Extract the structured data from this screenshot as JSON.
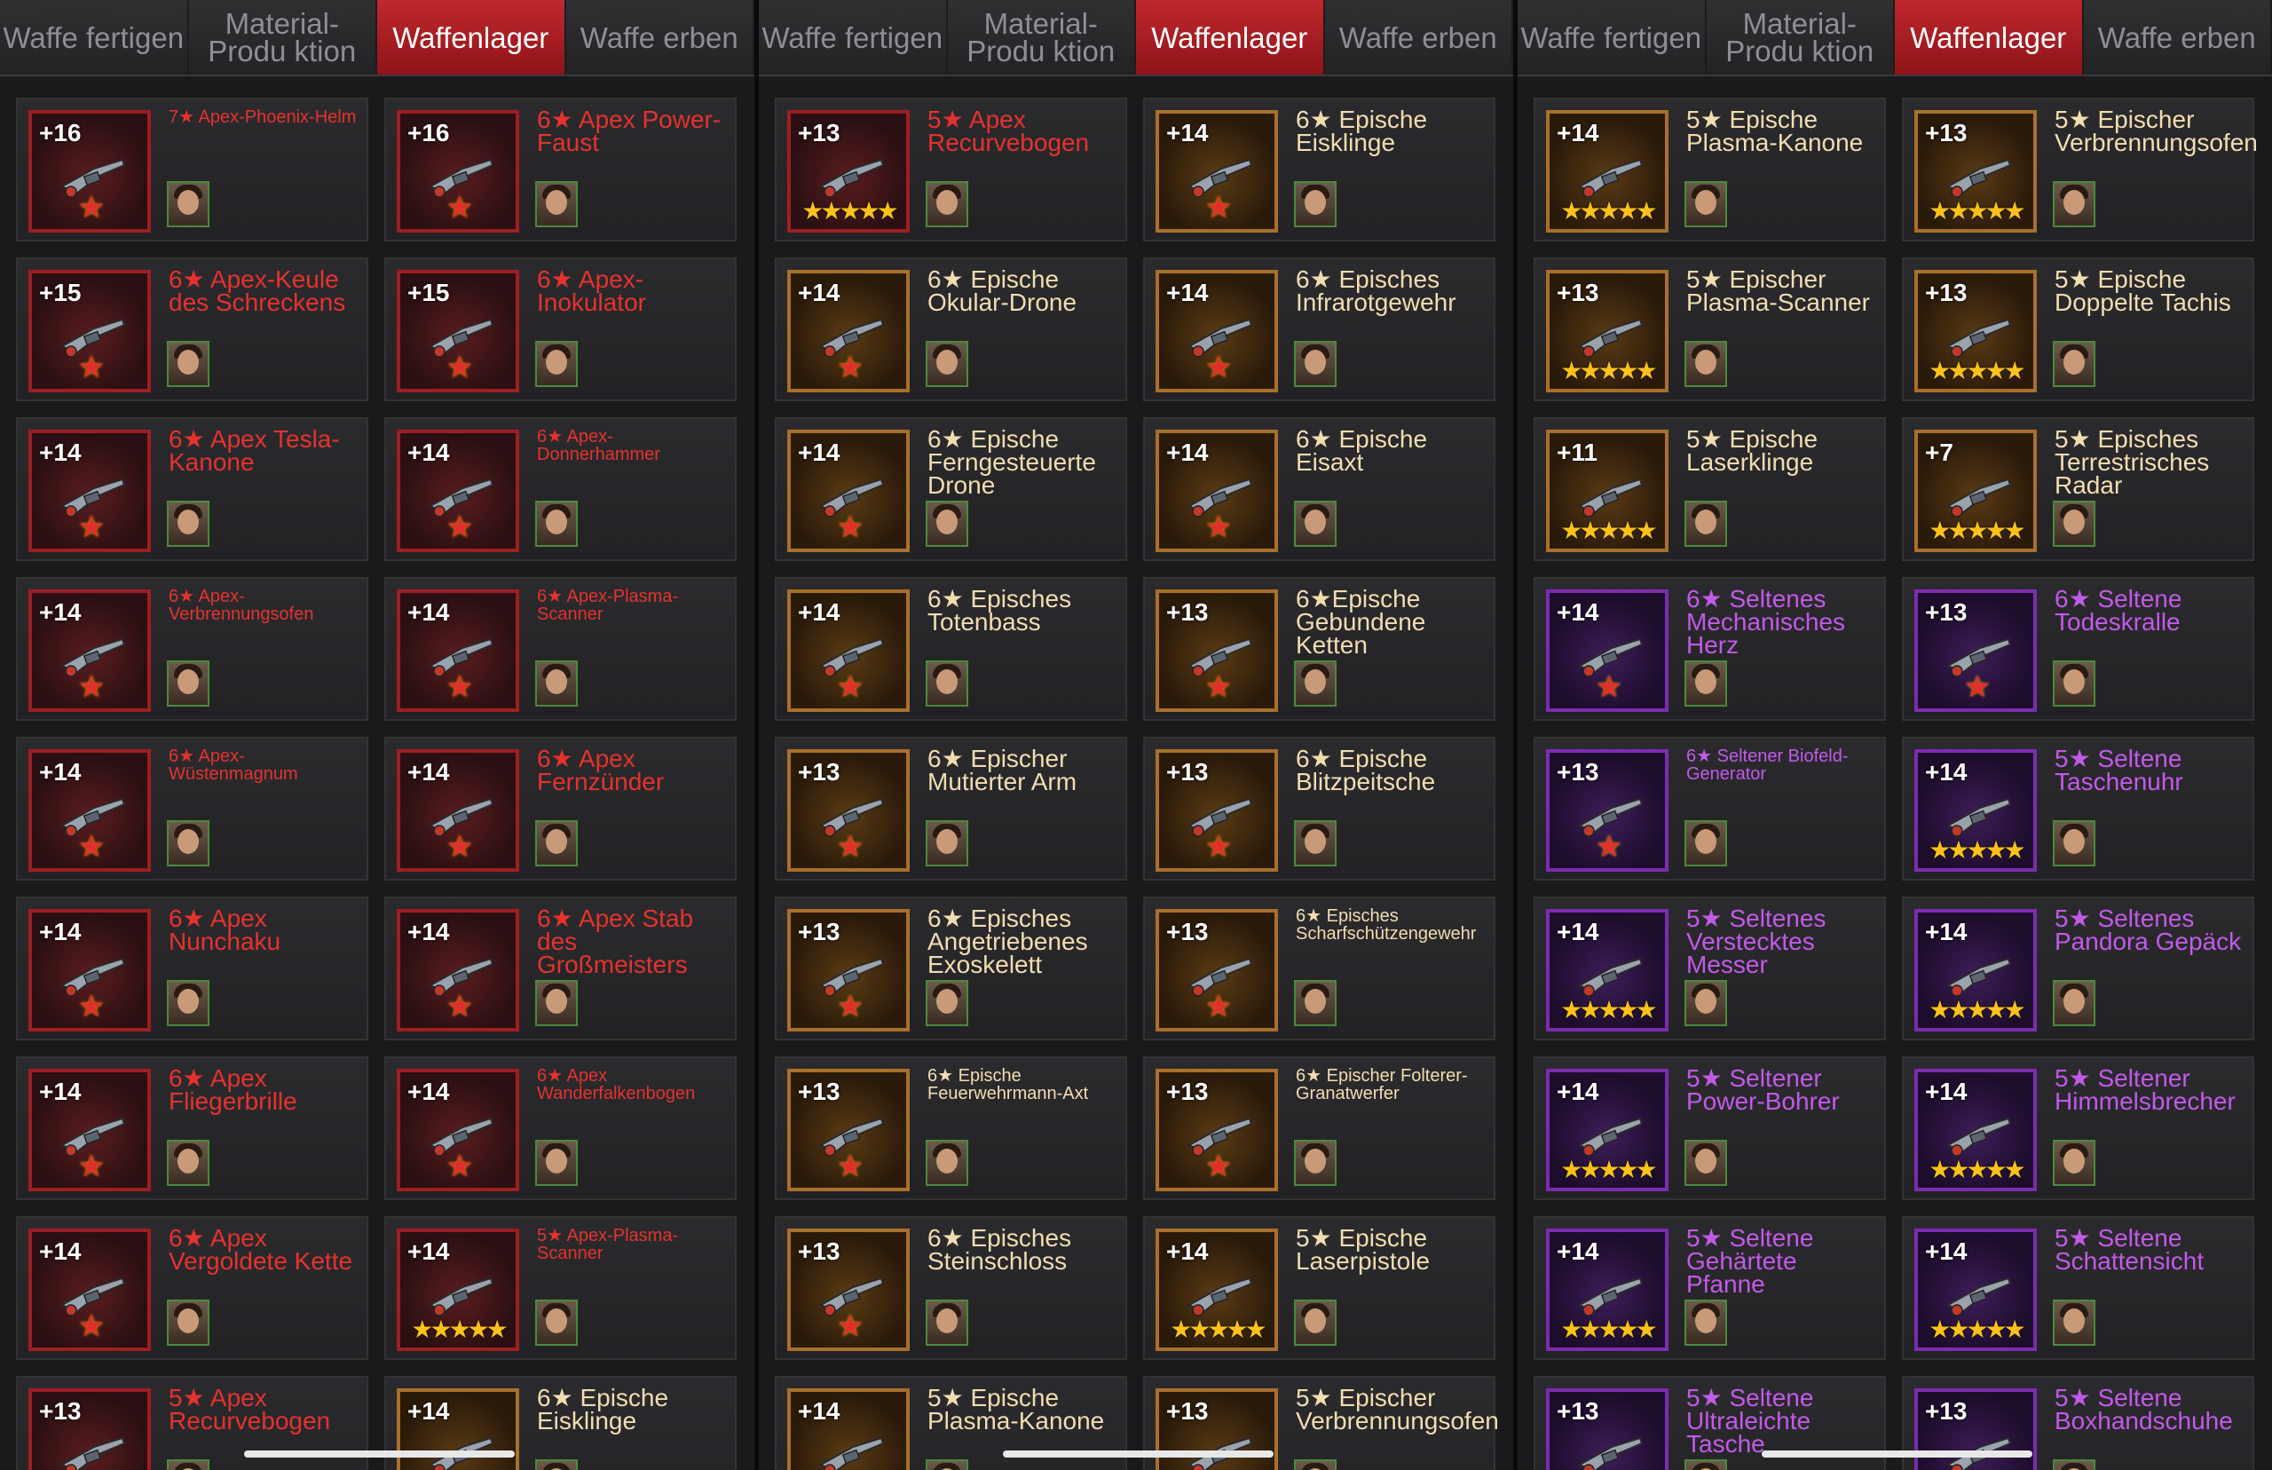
{
  "panels": [
    {
      "tabs": [
        {
          "label": "Waffe fertigen",
          "active": false
        },
        {
          "label": "Material-Produ ktion",
          "active": false
        },
        {
          "label": "Waffenlager",
          "active": true
        },
        {
          "label": "Waffe erben",
          "active": false
        }
      ],
      "items": [
        {
          "level": "+16",
          "name": "7★ Apex-Phoenix-Helm",
          "rarity": "apex",
          "stars": "★",
          "small": true,
          "icon": "helmet-icon"
        },
        {
          "level": "+16",
          "name": "6★ Apex Power-Faust",
          "rarity": "apex",
          "stars": "★",
          "small": false,
          "icon": "gauntlet-icon"
        },
        {
          "level": "+15",
          "name": "6★ Apex-Keule des Schreckens",
          "rarity": "apex",
          "stars": "★",
          "small": false,
          "icon": "club-icon"
        },
        {
          "level": "+15",
          "name": "6★ Apex-Inokulator",
          "rarity": "apex",
          "stars": "★",
          "small": false,
          "icon": "rifle-icon"
        },
        {
          "level": "+14",
          "name": "6★ Apex Tesla-Kanone",
          "rarity": "apex",
          "stars": "★",
          "small": false,
          "icon": "cannon-icon"
        },
        {
          "level": "+14",
          "name": "6★ Apex-Donnerhammer",
          "rarity": "apex",
          "stars": "★",
          "small": true,
          "icon": "hammer-icon"
        },
        {
          "level": "+14",
          "name": "6★ Apex-Verbrennungsofen",
          "rarity": "apex",
          "stars": "★",
          "small": true,
          "icon": "flamethrower-icon"
        },
        {
          "level": "+14",
          "name": "6★ Apex-Plasma-Scanner",
          "rarity": "apex",
          "stars": "★",
          "small": true,
          "icon": "scanner-icon"
        },
        {
          "level": "+14",
          "name": "6★ Apex-Wüstenmagnum",
          "rarity": "apex",
          "stars": "★",
          "small": true,
          "icon": "pistol-icon"
        },
        {
          "level": "+14",
          "name": "6★ Apex Fernzünder",
          "rarity": "apex",
          "stars": "★",
          "small": false,
          "icon": "detonator-icon"
        },
        {
          "level": "+14",
          "name": "6★ Apex Nunchaku",
          "rarity": "apex",
          "stars": "★",
          "small": false,
          "icon": "nunchaku-icon"
        },
        {
          "level": "+14",
          "name": "6★ Apex Stab des Großmeisters",
          "rarity": "apex",
          "stars": "★",
          "small": false,
          "icon": "staff-icon"
        },
        {
          "level": "+14",
          "name": "6★ Apex Fliegerbrille",
          "rarity": "apex",
          "stars": "★",
          "small": false,
          "icon": "goggles-icon"
        },
        {
          "level": "+14",
          "name": "6★ Apex Wanderfalkenbogen",
          "rarity": "apex",
          "stars": "★",
          "small": true,
          "icon": "crossbow-icon"
        },
        {
          "level": "+14",
          "name": "6★ Apex Vergoldete Kette",
          "rarity": "apex",
          "stars": "★",
          "small": false,
          "icon": "chain-icon"
        },
        {
          "level": "+14",
          "name": "5★ Apex-Plasma-Scanner",
          "rarity": "apex",
          "stars": "★★★★★",
          "small": true,
          "icon": "scanner-icon"
        },
        {
          "level": "+13",
          "name": "5★ Apex Recurvebogen",
          "rarity": "apex",
          "stars": "★★★★★",
          "small": false,
          "icon": "bow-icon"
        },
        {
          "level": "+14",
          "name": "6★ Epische Eisklinge",
          "rarity": "epic",
          "stars": "★",
          "small": false,
          "icon": "blade-icon"
        }
      ]
    },
    {
      "tabs": [
        {
          "label": "Waffe fertigen",
          "active": false
        },
        {
          "label": "Material-Produ ktion",
          "active": false
        },
        {
          "label": "Waffenlager",
          "active": true
        },
        {
          "label": "Waffe erben",
          "active": false
        }
      ],
      "items": [
        {
          "level": "+13",
          "name": "5★ Apex Recurvebogen",
          "rarity": "apex",
          "stars": "★★★★★",
          "small": false,
          "icon": "bow-icon"
        },
        {
          "level": "+14",
          "name": "6★ Epische Eisklinge",
          "rarity": "epic",
          "stars": "★",
          "small": false,
          "icon": "blade-icon"
        },
        {
          "level": "+14",
          "name": "6★ Epische Okular-Drone",
          "rarity": "epic",
          "stars": "★",
          "small": false,
          "icon": "drone-icon"
        },
        {
          "level": "+14",
          "name": "6★ Episches Infrarotgewehr",
          "rarity": "epic",
          "stars": "★",
          "small": false,
          "icon": "rifle-icon"
        },
        {
          "level": "+14",
          "name": "6★ Epische Ferngesteuerte Drone",
          "rarity": "epic",
          "stars": "★",
          "small": false,
          "icon": "drone-icon"
        },
        {
          "level": "+14",
          "name": "6★ Epische Eisaxt",
          "rarity": "epic",
          "stars": "★",
          "small": false,
          "icon": "axe-icon"
        },
        {
          "level": "+14",
          "name": "6★ Episches Totenbass",
          "rarity": "epic",
          "stars": "★",
          "small": false,
          "icon": "guitar-icon"
        },
        {
          "level": "+13",
          "name": "6★Epische Gebundene Ketten",
          "rarity": "epic",
          "stars": "★",
          "small": false,
          "icon": "chain-icon"
        },
        {
          "level": "+13",
          "name": "6★ Epischer Mutierter Arm",
          "rarity": "epic",
          "stars": "★",
          "small": false,
          "icon": "arm-icon"
        },
        {
          "level": "+13",
          "name": "6★ Epische Blitzpeitsche",
          "rarity": "epic",
          "stars": "★",
          "small": false,
          "icon": "whip-icon"
        },
        {
          "level": "+13",
          "name": "6★ Episches Angetriebenes Exoskelett",
          "rarity": "epic",
          "stars": "★",
          "small": false,
          "icon": "exoskeleton-icon"
        },
        {
          "level": "+13",
          "name": "6★ Episches Scharfschützengewehr",
          "rarity": "epic",
          "stars": "★",
          "small": true,
          "icon": "sniper-icon"
        },
        {
          "level": "+13",
          "name": "6★ Epische Feuerwehrmann-Axt",
          "rarity": "epic",
          "stars": "★",
          "small": true,
          "icon": "axe-icon"
        },
        {
          "level": "+13",
          "name": "6★ Epischer Folterer-Granatwerfer",
          "rarity": "epic",
          "stars": "★",
          "small": true,
          "icon": "launcher-icon"
        },
        {
          "level": "+13",
          "name": "6★ Episches Steinschloss",
          "rarity": "epic",
          "stars": "★",
          "small": false,
          "icon": "flintlock-icon"
        },
        {
          "level": "+14",
          "name": "5★ Epische Laserpistole",
          "rarity": "epic",
          "stars": "★★★★★",
          "small": false,
          "icon": "pistol-icon"
        },
        {
          "level": "+14",
          "name": "5★ Epische Plasma-Kanone",
          "rarity": "epic",
          "stars": "★★★★★",
          "small": false,
          "icon": "cannon-icon"
        },
        {
          "level": "+13",
          "name": "5★ Epischer Verbrennungsofen",
          "rarity": "epic",
          "stars": "★★★★★",
          "small": false,
          "icon": "flamethrower-icon"
        }
      ]
    },
    {
      "tabs": [
        {
          "label": "Waffe fertigen",
          "active": false
        },
        {
          "label": "Material-Produ ktion",
          "active": false
        },
        {
          "label": "Waffenlager",
          "active": true
        },
        {
          "label": "Waffe erben",
          "active": false
        }
      ],
      "items": [
        {
          "level": "+14",
          "name": "5★ Epische Plasma-Kanone",
          "rarity": "epic",
          "stars": "★★★★★",
          "small": false,
          "icon": "cannon-icon"
        },
        {
          "level": "+13",
          "name": "5★ Epischer Verbrennungsofen",
          "rarity": "epic",
          "stars": "★★★★★",
          "small": false,
          "icon": "flamethrower-icon"
        },
        {
          "level": "+13",
          "name": "5★ Epischer Plasma-Scanner",
          "rarity": "epic",
          "stars": "★★★★★",
          "small": false,
          "icon": "scanner-icon"
        },
        {
          "level": "+13",
          "name": "5★ Epische Doppelte Tachis",
          "rarity": "epic",
          "stars": "★★★★★",
          "small": false,
          "icon": "swords-icon"
        },
        {
          "level": "+11",
          "name": "5★ Epische Laserklinge",
          "rarity": "epic",
          "stars": "★★★★★",
          "small": false,
          "icon": "laser-blade-icon"
        },
        {
          "level": "+7",
          "name": "5★ Episches Terrestrisches Radar",
          "rarity": "epic",
          "stars": "★★★★★",
          "small": false,
          "icon": "radar-icon"
        },
        {
          "level": "+14",
          "name": "6★ Seltenes Mechanisches Herz",
          "rarity": "rare",
          "stars": "★",
          "small": false,
          "icon": "heart-icon"
        },
        {
          "level": "+13",
          "name": "6★ Seltene Todeskralle",
          "rarity": "rare",
          "stars": "★",
          "small": false,
          "icon": "claw-icon"
        },
        {
          "level": "+13",
          "name": "6★ Seltener Biofeld-Generator",
          "rarity": "rare",
          "stars": "★",
          "small": true,
          "icon": "generator-icon"
        },
        {
          "level": "+14",
          "name": "5★ Seltene Taschenuhr",
          "rarity": "rare",
          "stars": "★★★★★",
          "small": false,
          "icon": "watch-icon"
        },
        {
          "level": "+14",
          "name": "5★ Seltenes Verstecktes Messer",
          "rarity": "rare",
          "stars": "★★★★★",
          "small": false,
          "icon": "knife-icon"
        },
        {
          "level": "+14",
          "name": "5★ Seltenes Pandora Gepäck",
          "rarity": "rare",
          "stars": "★★★★★",
          "small": false,
          "icon": "case-icon"
        },
        {
          "level": "+14",
          "name": "5★ Seltener Power-Bohrer",
          "rarity": "rare",
          "stars": "★★★★★",
          "small": false,
          "icon": "drill-icon"
        },
        {
          "level": "+14",
          "name": "5★ Seltener Himmelsbrecher",
          "rarity": "rare",
          "stars": "★★★★★",
          "small": false,
          "icon": "hammer-icon"
        },
        {
          "level": "+14",
          "name": "5★ Seltene Gehärtete Pfanne",
          "rarity": "rare",
          "stars": "★★★★★",
          "small": false,
          "icon": "pan-icon"
        },
        {
          "level": "+14",
          "name": "5★ Seltene Schattensicht",
          "rarity": "rare",
          "stars": "★★★★★",
          "small": false,
          "icon": "scope-icon"
        },
        {
          "level": "+13",
          "name": "5★ Seltene Ultraleichte Tasche",
          "rarity": "rare",
          "stars": "★★★★★",
          "small": false,
          "icon": "bag-icon"
        },
        {
          "level": "+13",
          "name": "5★ Seltene Boxhandschuhe",
          "rarity": "rare",
          "stars": "★★★★★",
          "small": false,
          "icon": "glove-icon"
        }
      ]
    }
  ],
  "colors": {
    "apex": "#e5322e",
    "epic": "#f2ddb0",
    "rare": "#c25ae8",
    "active_tab": "#b3242a"
  }
}
